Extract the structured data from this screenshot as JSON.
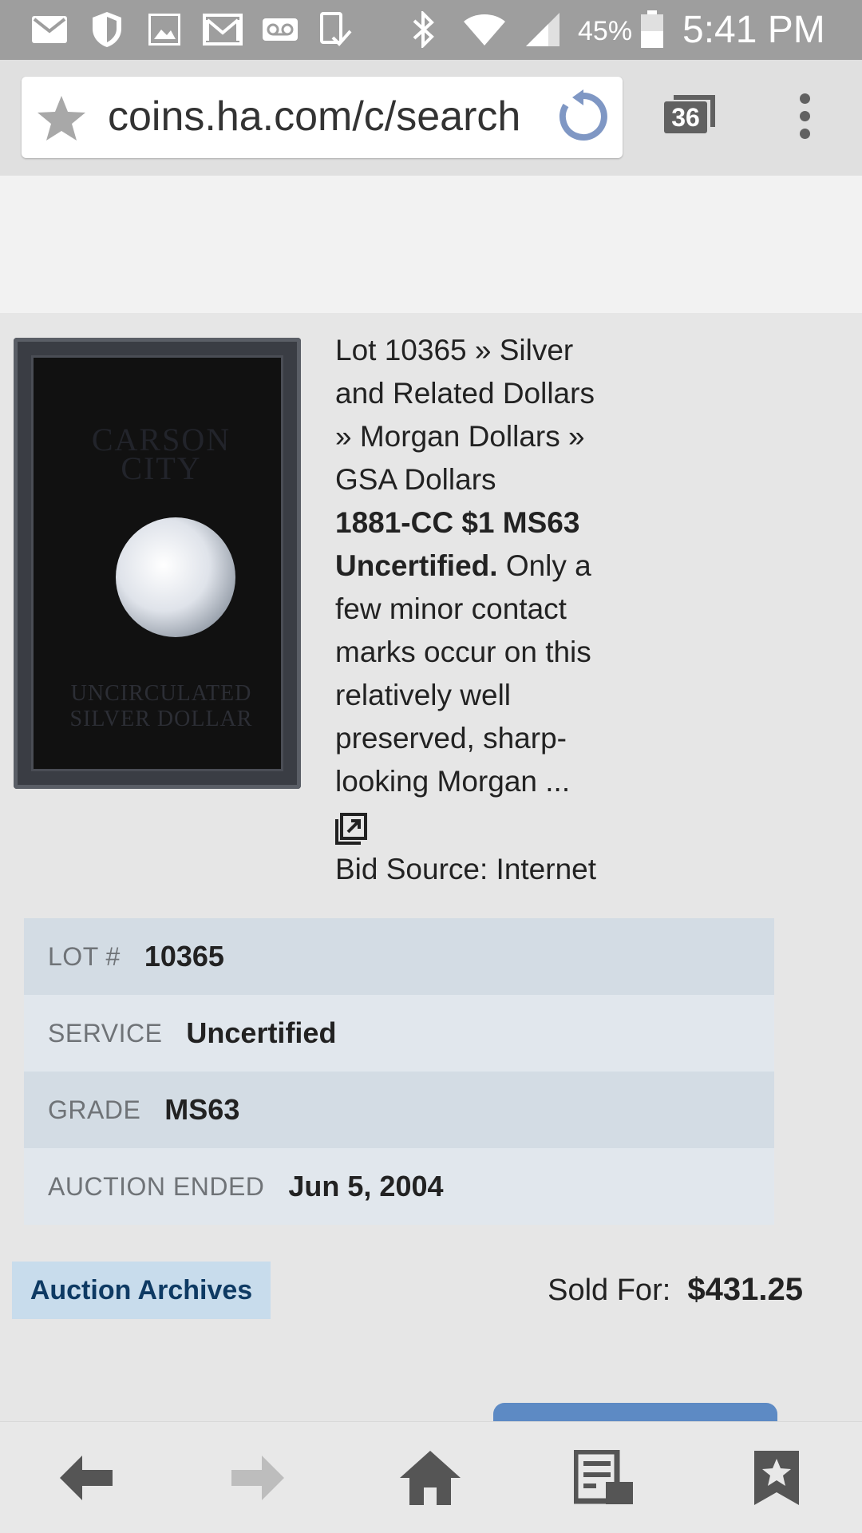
{
  "status_bar": {
    "battery": "45%",
    "time": "5:41 PM",
    "icons": [
      "mail-icon",
      "shield-icon",
      "image-icon",
      "gmail-icon",
      "voicemail-icon",
      "device-check-icon",
      "bluetooth-icon",
      "wifi-icon",
      "signal-icon",
      "battery-icon"
    ]
  },
  "browser": {
    "url": "coins.ha.com/c/search",
    "tab_count": "36"
  },
  "lot": {
    "breadcrumb": [
      "Lot 10365 » Silver",
      "and Related Dollars",
      "» Morgan Dollars »",
      "GSA Dollars"
    ],
    "title_bold": [
      "1881-CC $1 MS63",
      "Uncertified."
    ],
    "description": [
      "Only a",
      "few minor contact",
      "marks occur on this",
      "relatively well",
      "preserved, sharp-",
      "looking Morgan ..."
    ],
    "bid_source": "Bid Source: Internet",
    "image": {
      "brand": "CARSON CITY",
      "bottom": "UNCIRCULATED SILVER DOLLAR"
    }
  },
  "details": [
    {
      "label": "LOT #",
      "value": "10365"
    },
    {
      "label": "SERVICE",
      "value": "Uncertified"
    },
    {
      "label": "GRADE",
      "value": "MS63"
    },
    {
      "label": "AUCTION ENDED",
      "value": "Jun 5, 2004"
    }
  ],
  "auction_archives": "Auction Archives",
  "sold": {
    "label": "Sold For:",
    "price": "$431.25"
  },
  "colors": {
    "status_bar": "#9e9e9e",
    "row_odd": "#d3dce4",
    "row_even": "#e1e7ed",
    "archives_bg": "#c8dcec",
    "archives_text": "#0e3a63",
    "offer_button": "#5d8ac4"
  },
  "bottom_nav": [
    "back-arrow-icon",
    "forward-arrow-icon",
    "home-icon",
    "reading-list-icon",
    "bookmark-star-icon"
  ]
}
